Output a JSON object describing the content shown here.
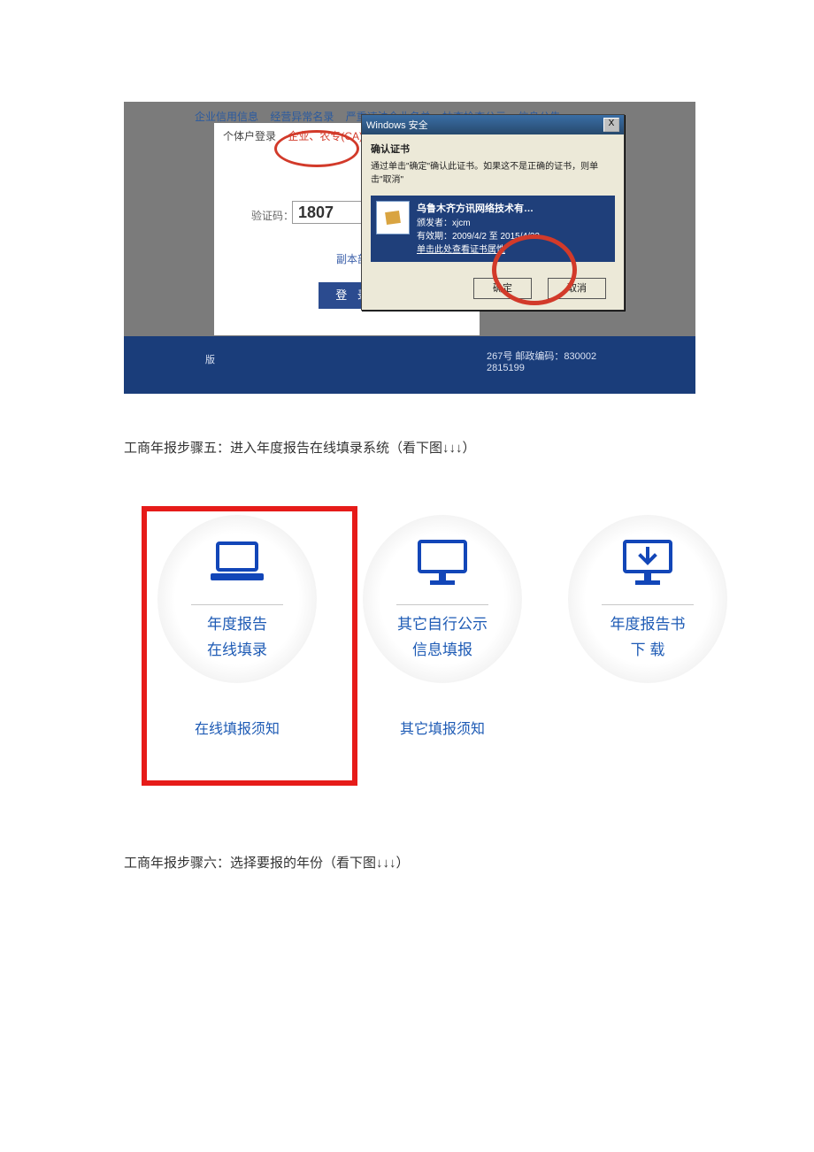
{
  "screenshot1": {
    "menu_items": [
      "企业信用信息",
      "经营异常名录",
      "严重违法企业名单",
      "抽查检查公示",
      "信息公告"
    ],
    "tab_individual": "个体户登录",
    "tab_enterprise": "企业、农专(CA)登录",
    "captcha_label": "验证码：",
    "captcha_value": "1807",
    "sub_label": "副本部",
    "login_button": "登 录",
    "footer_left": "版",
    "footer_right1": "267号  邮政编码：830002",
    "footer_right2": "2815199",
    "dialog": {
      "title": "Windows 安全",
      "heading": "确认证书",
      "message": "通过单击\"确定\"确认此证书。如果这不是正确的证书，则单击\"取消\"",
      "cert_name": "乌鲁木齐方讯网络技术有…",
      "cert_issuer": "颁发者：xjcm",
      "cert_valid": "有效期：2009/4/2 至 2015/4/22",
      "cert_link": "单击此处查看证书属性",
      "ok": "确定",
      "cancel": "取消"
    }
  },
  "step5_text": "工商年报步骤五：进入年度报告在线填录系统（看下图↓↓↓）",
  "options": {
    "opt1_line1": "年度报告",
    "opt1_line2": "在线填录",
    "opt1_link": "在线填报须知",
    "opt2_line1": "其它自行公示",
    "opt2_line2": "信息填报",
    "opt2_link": "其它填报须知",
    "opt3_line1": "年度报告书",
    "opt3_line2": "下 载"
  },
  "step6_text": "工商年报步骤六：选择要报的年份（看下图↓↓↓）"
}
